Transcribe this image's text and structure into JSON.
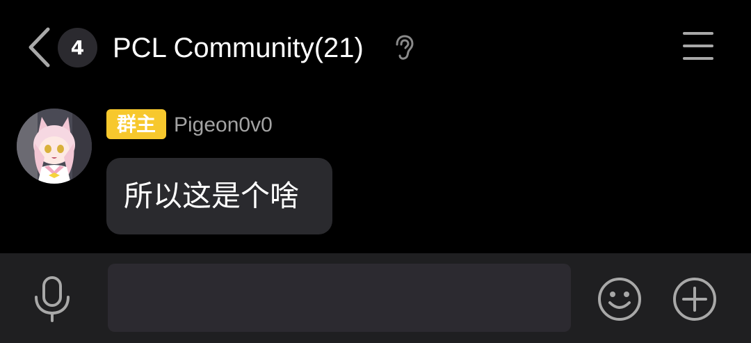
{
  "header": {
    "unread_count": "4",
    "title": "PCL Community(21)",
    "icons": {
      "back": "chevron-left-icon",
      "earpiece": "ear-icon",
      "menu": "hamburger-menu-icon"
    }
  },
  "message": {
    "role_badge": "群主",
    "sender": "Pigeon0v0",
    "text": "所以这是个啥"
  },
  "input_bar": {
    "value": "",
    "placeholder": "",
    "icons": {
      "voice": "microphone-icon",
      "emoji": "smiley-face-icon",
      "more": "plus-circle-icon"
    }
  },
  "colors": {
    "background": "#000000",
    "bubble": "#2a2a2e",
    "badge": "#f7c82d",
    "input_bar": "#1f1f21",
    "icon_gray": "#a8a8a8"
  }
}
